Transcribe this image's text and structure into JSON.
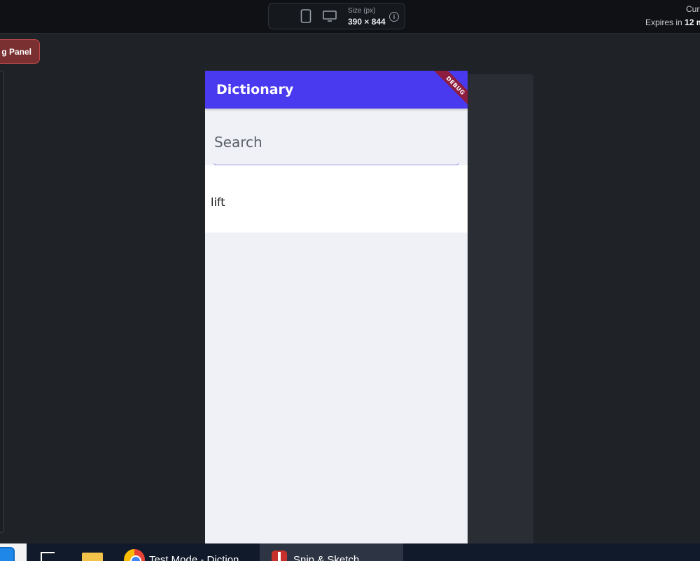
{
  "toolbar": {
    "devices": [
      {
        "name": "phone",
        "icon": "phone-icon",
        "active": true
      },
      {
        "name": "tablet",
        "icon": "tablet-icon",
        "active": false
      },
      {
        "name": "desktop",
        "icon": "monitor-icon",
        "active": false
      }
    ],
    "size_label": "Size (px)",
    "size_value": "390 × 844",
    "info_icon": "info-icon",
    "right_line1": "Curr",
    "right_line2_prefix": "Expires in ",
    "right_line2_bold": "12 m"
  },
  "left_panel": {
    "button_label": "g Panel"
  },
  "app": {
    "title": "Dictionary",
    "debug_banner": "DEBUG",
    "search_placeholder": "Search",
    "results": [
      "lift"
    ],
    "colors": {
      "app_bar": "#4a3aef",
      "debug_banner": "#8f1d3f",
      "background": "#f0f1f6",
      "search_underline": "#9f99ea"
    }
  },
  "taskbar": {
    "items": [
      {
        "icon": "start-icon",
        "label": ""
      },
      {
        "icon": "task-view-icon",
        "label": ""
      },
      {
        "icon": "folder-icon",
        "label": ""
      },
      {
        "icon": "chrome-icon",
        "label": "Test Mode - Diction"
      },
      {
        "icon": "snip-sketch-icon",
        "label": "Snip & Sketch"
      }
    ]
  }
}
